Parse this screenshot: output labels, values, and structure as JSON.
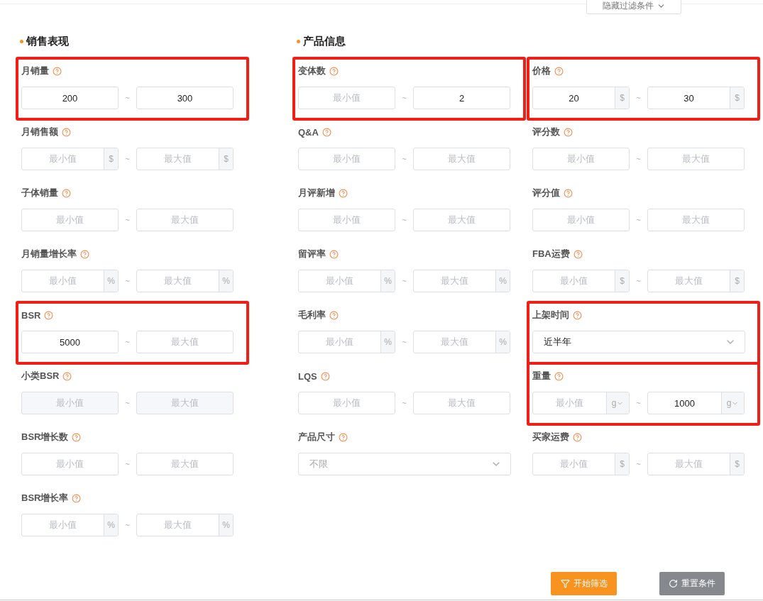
{
  "toggle_button": {
    "label": "隐藏过滤条件"
  },
  "sections": [
    {
      "title": "销售表现",
      "columns": [
        [
          {
            "label": "月销量",
            "kind": "range",
            "highlighted": true,
            "min": {
              "value": "200"
            },
            "separator": "~",
            "max": {
              "value": "300"
            }
          },
          {
            "label": "月销售额",
            "kind": "range",
            "highlighted": false,
            "min": {
              "placeholder": "最小值",
              "unit": "$"
            },
            "separator": "~",
            "max": {
              "placeholder": "最大值",
              "unit": "$"
            }
          },
          {
            "label": "子体销量",
            "kind": "range",
            "highlighted": false,
            "min": {
              "placeholder": "最小值"
            },
            "separator": "~",
            "max": {
              "placeholder": "最大值"
            }
          },
          {
            "label": "月销量增长率",
            "kind": "range",
            "highlighted": false,
            "min": {
              "placeholder": "最小值",
              "unit": "%"
            },
            "separator": "~",
            "max": {
              "placeholder": "最大值",
              "unit": "%"
            }
          },
          {
            "label": "BSR",
            "kind": "range",
            "highlighted": true,
            "min": {
              "value": "5000"
            },
            "separator": "~",
            "max": {
              "placeholder": "最大值"
            }
          },
          {
            "label": "小类BSR",
            "kind": "range",
            "highlighted": false,
            "disabled": true,
            "min": {
              "placeholder": "最小值"
            },
            "separator": "~",
            "max": {
              "placeholder": "最大值"
            }
          },
          {
            "label": "BSR增长数",
            "kind": "range",
            "highlighted": false,
            "min": {
              "placeholder": "最小值"
            },
            "separator": "~",
            "max": {
              "placeholder": "最大值"
            }
          },
          {
            "label": "BSR增长率",
            "kind": "range",
            "highlighted": false,
            "min": {
              "placeholder": "最小值",
              "unit": "%"
            },
            "separator": "~",
            "max": {
              "placeholder": "最大值",
              "unit": "%"
            }
          }
        ]
      ]
    },
    {
      "title": "产品信息",
      "columns": [
        [
          {
            "label": "变体数",
            "kind": "range",
            "highlighted": true,
            "min": {
              "placeholder": "最小值"
            },
            "separator": "~",
            "max": {
              "value": "2"
            }
          },
          {
            "label": "Q&A",
            "kind": "range",
            "highlighted": false,
            "min": {
              "placeholder": "最小值"
            },
            "separator": "~",
            "max": {
              "placeholder": "最大值"
            }
          },
          {
            "label": "月评新增",
            "kind": "range",
            "highlighted": false,
            "min": {
              "placeholder": "最小值"
            },
            "separator": "~",
            "max": {
              "placeholder": "最大值"
            }
          },
          {
            "label": "留评率",
            "kind": "range",
            "highlighted": false,
            "min": {
              "placeholder": "最小值",
              "unit": "%"
            },
            "separator": "~",
            "max": {
              "placeholder": "最大值",
              "unit": "%"
            }
          },
          {
            "label": "毛利率",
            "kind": "range",
            "highlighted": false,
            "min": {
              "placeholder": "最小值",
              "unit": "%"
            },
            "separator": "~",
            "max": {
              "placeholder": "最大值",
              "unit": "%"
            }
          },
          {
            "label": "LQS",
            "kind": "range",
            "highlighted": false,
            "min": {
              "placeholder": "最小值"
            },
            "separator": "~",
            "max": {
              "placeholder": "最大值"
            }
          },
          {
            "label": "产品尺寸",
            "kind": "select",
            "highlighted": false,
            "placeholder": "不限"
          }
        ],
        [
          {
            "label": "价格",
            "kind": "range",
            "highlighted": true,
            "min": {
              "value": "20",
              "unit": "$"
            },
            "separator": "~",
            "max": {
              "value": "30",
              "unit": "$"
            }
          },
          {
            "label": "评分数",
            "kind": "range",
            "highlighted": false,
            "min": {
              "placeholder": "最小值"
            },
            "separator": "~",
            "max": {
              "placeholder": "最大值"
            }
          },
          {
            "label": "评分值",
            "kind": "range",
            "highlighted": false,
            "min": {
              "placeholder": "最小值"
            },
            "separator": "~",
            "max": {
              "placeholder": "最大值"
            }
          },
          {
            "label": "FBA运费",
            "kind": "range",
            "highlighted": false,
            "min": {
              "placeholder": "最小值",
              "unit": "$"
            },
            "separator": "~",
            "max": {
              "placeholder": "最大值",
              "unit": "$"
            }
          },
          {
            "label": "上架时间",
            "kind": "select",
            "highlighted": true,
            "value": "近半年"
          },
          {
            "label": "重量",
            "kind": "range",
            "highlighted": true,
            "min": {
              "placeholder": "最小值",
              "unit": "g",
              "unit_dropdown": true
            },
            "separator": "~",
            "max": {
              "value": "1000",
              "unit": "g",
              "unit_dropdown": true
            }
          },
          {
            "label": "买家运费",
            "kind": "range",
            "highlighted": false,
            "min": {
              "placeholder": "最小值",
              "unit": "$"
            },
            "separator": "~",
            "max": {
              "placeholder": "最大值",
              "unit": "$"
            }
          }
        ]
      ]
    }
  ],
  "buttons": [
    {
      "label": "开始筛选",
      "kind": "primary"
    },
    {
      "label": "重置条件",
      "kind": "reset"
    }
  ]
}
